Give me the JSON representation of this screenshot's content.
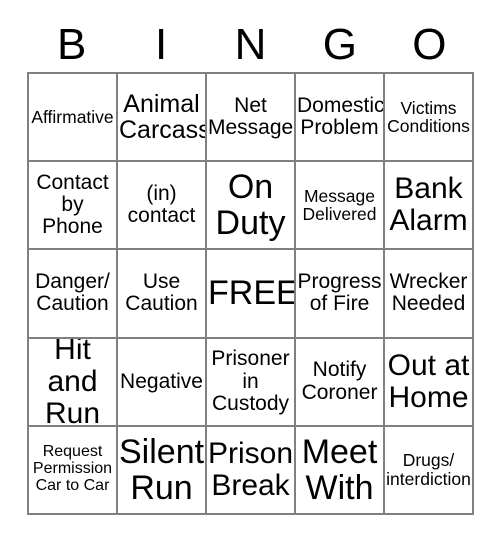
{
  "header": {
    "letters": [
      "B",
      "I",
      "N",
      "G",
      "O"
    ]
  },
  "grid": {
    "columns": 5,
    "rows": 5,
    "cells": [
      {
        "text": "Affirmative",
        "size": "sm"
      },
      {
        "text": "Animal\nCarcass",
        "size": "lg"
      },
      {
        "text": "Net\nMessage",
        "size": "md"
      },
      {
        "text": "Domestic\nProblem",
        "size": "md"
      },
      {
        "text": "Victims\nConditions",
        "size": "sm"
      },
      {
        "text": "Contact\nby\nPhone",
        "size": "md"
      },
      {
        "text": "(in)\ncontact",
        "size": "md"
      },
      {
        "text": "On\nDuty",
        "size": "xxl"
      },
      {
        "text": "Message\nDelivered",
        "size": "sm"
      },
      {
        "text": "Bank\nAlarm",
        "size": "xl"
      },
      {
        "text": "Danger/\nCaution",
        "size": "md"
      },
      {
        "text": "Use\nCaution",
        "size": "md"
      },
      {
        "text": "FREE",
        "size": "xxl"
      },
      {
        "text": "Progress\nof Fire",
        "size": "md"
      },
      {
        "text": "Wrecker\nNeeded",
        "size": "md"
      },
      {
        "text": "Hit and\nRun",
        "size": "xl"
      },
      {
        "text": "Negative",
        "size": "md"
      },
      {
        "text": "Prisoner\nin\nCustody",
        "size": "md"
      },
      {
        "text": "Notify\nCoroner",
        "size": "md"
      },
      {
        "text": "Out at\nHome",
        "size": "xl"
      },
      {
        "text": "Request\nPermission\nCar to Car",
        "size": "xs"
      },
      {
        "text": "Silent\nRun",
        "size": "xxl"
      },
      {
        "text": "Prison\nBreak",
        "size": "xl"
      },
      {
        "text": "Meet\nWith",
        "size": "xxl"
      },
      {
        "text": "Drugs/\ninterdiction",
        "size": "sm"
      }
    ]
  },
  "colors": {
    "border": "#808080",
    "text": "#000000",
    "background": "#ffffff"
  }
}
